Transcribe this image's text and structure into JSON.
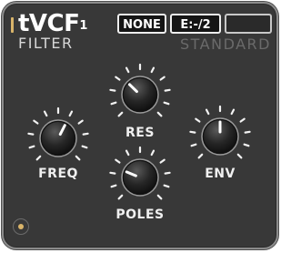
{
  "header": {
    "title": "tVCF",
    "title_suffix": "1",
    "subtitle": "FILTER",
    "mode_label": "STANDARD",
    "accent_color": "#d9b46a"
  },
  "selectors": [
    {
      "value": "NONE"
    },
    {
      "value": "E:-/2"
    },
    {
      "value": ""
    }
  ],
  "knobs": {
    "res": {
      "label": "RES",
      "value": 0.33
    },
    "freq": {
      "label": "FREQ",
      "value": 0.6
    },
    "env": {
      "label": "ENV",
      "value": 0.5
    },
    "poles": {
      "label": "POLES",
      "value": 0.25
    }
  }
}
